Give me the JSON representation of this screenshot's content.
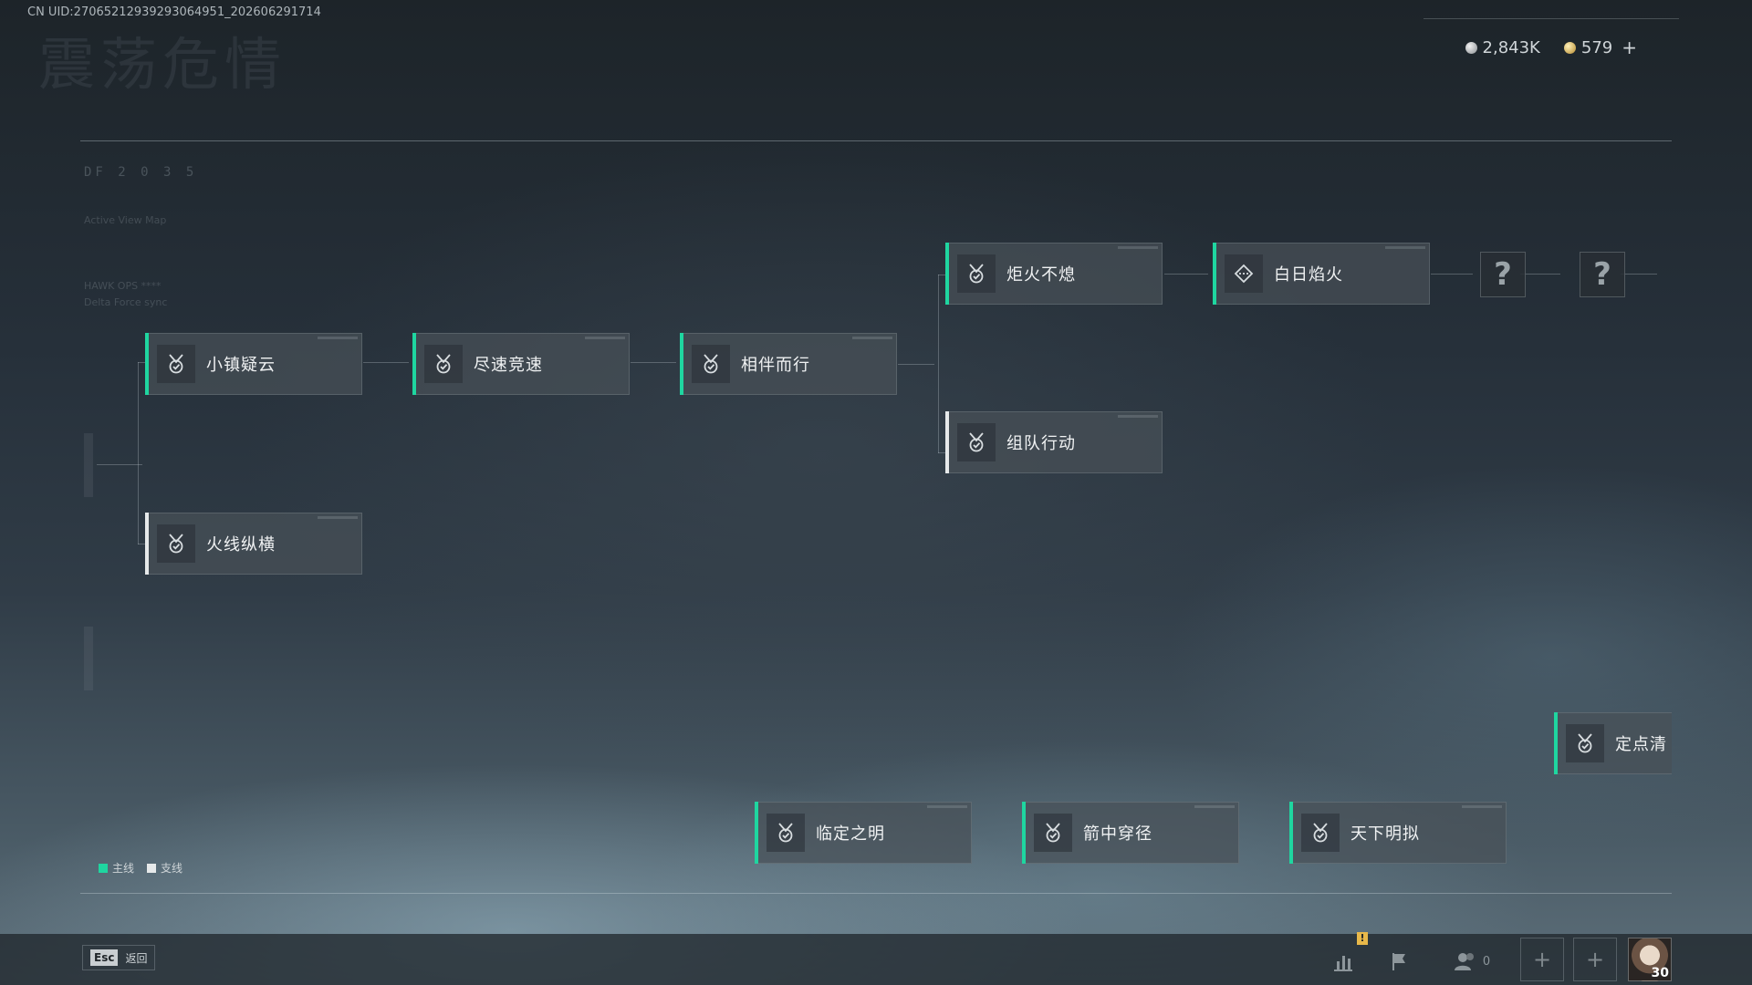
{
  "header": {
    "uid": "CN UID:2706521293929306495​1_202606291714",
    "bg_title": "震荡危情"
  },
  "currency": [
    {
      "icon": "silver-coin-icon",
      "value": "2,843K"
    },
    {
      "icon": "gold-coin-icon",
      "value": "579"
    }
  ],
  "currency_add": "+",
  "deco": {
    "code": "DF 2 0 3 5",
    "line1": "Active View Map",
    "line2": "HAWK OPS ****",
    "line3": "Delta Force sync"
  },
  "missions": [
    {
      "id": "m1",
      "label": "小镇疑云",
      "type": "main",
      "icon": "medal-check-icon"
    },
    {
      "id": "m2",
      "label": "尽速竞速",
      "type": "main",
      "icon": "medal-check-icon"
    },
    {
      "id": "m3",
      "label": "相伴而行",
      "type": "main",
      "icon": "medal-check-icon"
    },
    {
      "id": "m4",
      "label": "炬火不熄",
      "type": "main",
      "icon": "medal-check-icon"
    },
    {
      "id": "m5",
      "label": "白日焰火",
      "type": "main",
      "icon": "diamond-target-icon"
    },
    {
      "id": "m6",
      "label": "组队行动",
      "type": "side",
      "icon": "medal-check-icon"
    },
    {
      "id": "m7",
      "label": "火线纵横",
      "type": "side",
      "icon": "medal-check-icon"
    },
    {
      "id": "m8",
      "label": "定点清",
      "type": "main",
      "icon": "medal-check-icon"
    },
    {
      "id": "m9",
      "label": "临定之明",
      "type": "main",
      "icon": "medal-check-icon"
    },
    {
      "id": "m10",
      "label": "箭中穿径",
      "type": "main",
      "icon": "medal-check-icon"
    },
    {
      "id": "m11",
      "label": "天下明拟",
      "type": "main",
      "icon": "medal-check-icon"
    }
  ],
  "unknown": "?",
  "legend": {
    "main": "主线",
    "side": "支线",
    "main_color": "#1fd6a0",
    "side_color": "#e6e9ea"
  },
  "bottom": {
    "esc_key": "Esc",
    "esc_label": "返回",
    "friends_count": "0",
    "level": "30",
    "warn": "!"
  }
}
